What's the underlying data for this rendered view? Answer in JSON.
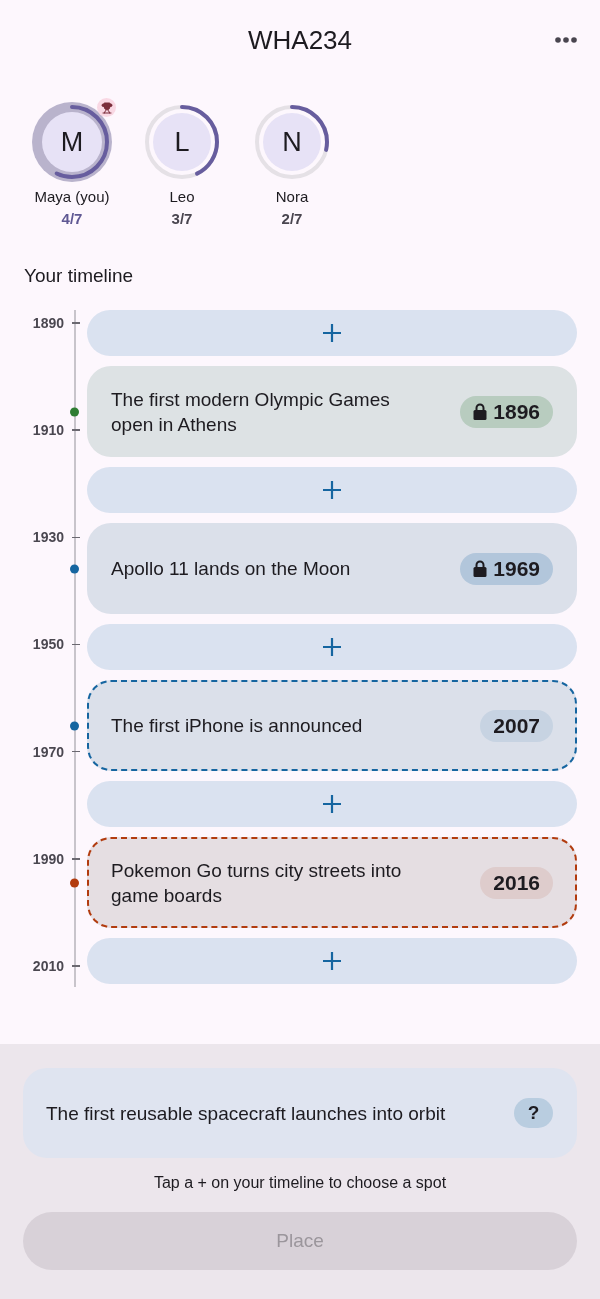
{
  "header": {
    "title": "WHA234"
  },
  "players": [
    {
      "initial": "M",
      "name": "Maya (you)",
      "score": "4/7",
      "level": 0.5714,
      "current": true,
      "leader": true
    },
    {
      "initial": "L",
      "name": "Leo",
      "score": "3/7",
      "level": 0.4286,
      "current": false,
      "leader": false
    },
    {
      "initial": "N",
      "name": "Nora",
      "score": "2/7",
      "level": 0.2857,
      "current": false,
      "leader": false
    }
  ],
  "timeline": {
    "title": "Your timeline",
    "ticks": [
      "1890",
      "1910",
      "1930",
      "1950",
      "1970",
      "1990",
      "2010"
    ],
    "items": [
      {
        "kind": "slot",
        "selected": false
      },
      {
        "kind": "card",
        "text": "The first modern Olympic Games open in Athens",
        "year": "1896",
        "locked": true,
        "color": "#2e7d32"
      },
      {
        "kind": "slot",
        "selected": false
      },
      {
        "kind": "card",
        "text": "Apollo 11 lands on the Moon",
        "year": "1969",
        "locked": true,
        "color": "#1565a0"
      },
      {
        "kind": "slot",
        "selected": false
      },
      {
        "kind": "card",
        "text": "The first iPhone is announced",
        "year": "2007",
        "locked": false,
        "color": "#1565a0"
      },
      {
        "kind": "slot",
        "selected": false
      },
      {
        "kind": "card",
        "text": "Pokemon Go turns city streets into game boards",
        "year": "2016",
        "locked": false,
        "color": "#b23b0e"
      },
      {
        "kind": "slot",
        "selected": false
      }
    ]
  },
  "current_event": {
    "text": "The first reusable spacecraft launches into orbit",
    "year": "?"
  },
  "hint": "Tap a + on your timeline to choose a spot",
  "place_button": {
    "label": "Place",
    "disabled": true
  }
}
